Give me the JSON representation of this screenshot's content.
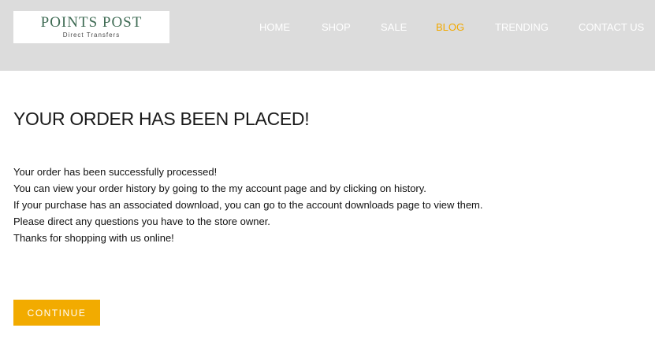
{
  "brand": {
    "name": "POINTS POST",
    "tagline": "Direct Transfers"
  },
  "nav": {
    "items": [
      {
        "label": "HOME"
      },
      {
        "label": "SHOP"
      },
      {
        "label": "SALE"
      },
      {
        "label": "BLOG",
        "active": true
      },
      {
        "label": "TRENDING"
      },
      {
        "label": "CONTACT US"
      }
    ]
  },
  "main": {
    "title": "YOUR ORDER HAS BEEN PLACED!",
    "lines": [
      "Your order has been successfully processed!",
      "You can view your order history by going to the my account page and by clicking on history.",
      "If your purchase has an associated download, you can go to the account downloads page to view them.",
      "Please direct any questions you have to the store owner.",
      "Thanks for shopping with us online!"
    ],
    "continue_label": "CONTINUE"
  },
  "colors": {
    "header_bg": "#dcdcdc",
    "accent": "#f2ab00",
    "logo_text": "#3f6b54"
  }
}
